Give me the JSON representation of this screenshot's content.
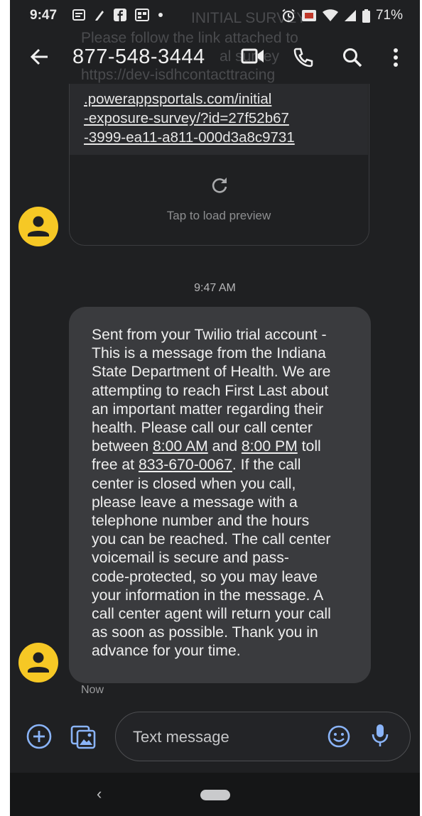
{
  "status_bar": {
    "time": "9:47",
    "battery": "71%"
  },
  "background_ghost": {
    "line1": "INITIAL SURVEY",
    "line2": "Please follow the link attached to",
    "line3": "al survey",
    "line4": "https://dev-isdhcontacttracing"
  },
  "app_bar": {
    "title": "877-548-3444",
    "icons": [
      "back-arrow-icon",
      "video-call-icon",
      "phone-call-icon",
      "search-icon",
      "more-vert-icon"
    ]
  },
  "link_message": {
    "link_text": ".powerappsportals.com/initial\n-exposure-survey/?id=27f52b67\n-3999-ea11-a811-000d3a8c9731",
    "preview_label": "Tap to load preview"
  },
  "timestamp": "9:47 AM",
  "message": {
    "line1": "Sent from your Twilio trial account -",
    "line2": "This is a message from the Indiana",
    "line3": "State Department of Health. We are",
    "line4": "attempting to reach First Last about",
    "line5": "an important matter regarding their",
    "line6": "health. Please call our call center",
    "line7_a": "between ",
    "line7_time1": "8:00 AM",
    "line7_b": " and ",
    "line7_time2": "8:00 PM",
    "line7_c": " toll",
    "line8_a": "free at ",
    "line8_phone": "833-670-0067",
    "line8_b": ". If the call",
    "line9": "center is closed when you call,",
    "line10": "please leave a message with a",
    "line11": "telephone number and the hours",
    "line12": "you can be reached. The call center",
    "line13": "voicemail is secure and pass-",
    "line14": "code-protected, so you may leave",
    "line15": "your information in the message. A",
    "line16": "call center agent will return your call",
    "line17": "as soon as possible. Thank you in",
    "line18": "advance for your time.",
    "status": "Now"
  },
  "composer": {
    "placeholder": "Text message"
  },
  "nav_bar": {
    "back_glyph": "‹"
  },
  "colors": {
    "background": "#1f2022",
    "bubble": "#3a3b3e",
    "avatar": "#f6c825",
    "accent": "#8ab4f8"
  }
}
